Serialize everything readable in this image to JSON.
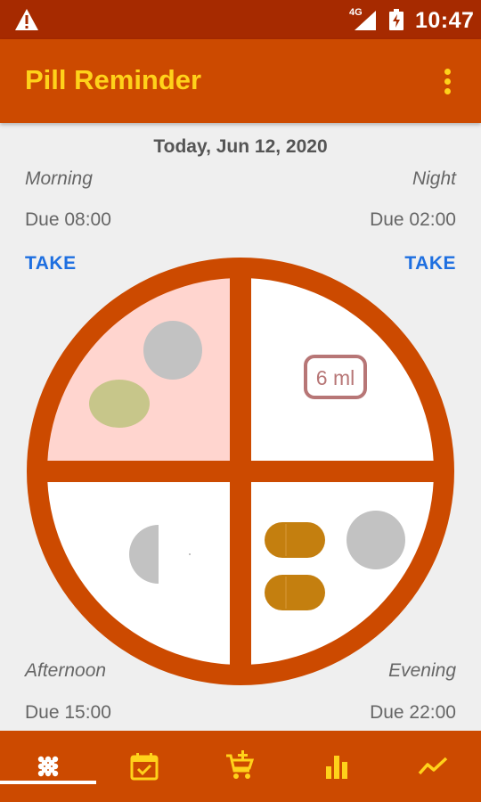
{
  "status_bar": {
    "network": "4G",
    "time": "10:47"
  },
  "app_bar": {
    "title": "Pill Reminder",
    "menu_icon": "more-vert-icon"
  },
  "schedule": {
    "date_title": "Today, Jun 12, 2020",
    "morning": {
      "name": "Morning",
      "due": "Due 08:00",
      "action": "TAKE"
    },
    "night": {
      "name": "Night",
      "due": "Due 02:00",
      "action": "TAKE"
    },
    "afternoon": {
      "name": "Afternoon",
      "due": "Due 15:00"
    },
    "evening": {
      "name": "Evening",
      "due": "Due 22:00"
    }
  },
  "wheel": {
    "dose_label": "6 ml",
    "colors": {
      "ring": "#cc4a00",
      "morning_fill": "#ffd5cf",
      "quarter_fill": "#ffffff",
      "pill_gray": "#c2c2c2",
      "pill_olive": "#c7c68a",
      "capsule": "#c47f0f",
      "dose_badge": "#b77676"
    }
  },
  "bottom_nav": {
    "active_index": 0,
    "items": [
      {
        "icon": "pills-grid-icon"
      },
      {
        "icon": "calendar-check-icon"
      },
      {
        "icon": "cart-add-icon"
      },
      {
        "icon": "bar-chart-icon"
      },
      {
        "icon": "trend-line-icon"
      }
    ]
  },
  "theme": {
    "status_bar": "#a62a00",
    "primary": "#cc4a00",
    "accent": "#ffd21a",
    "link": "#1e6fe0"
  }
}
